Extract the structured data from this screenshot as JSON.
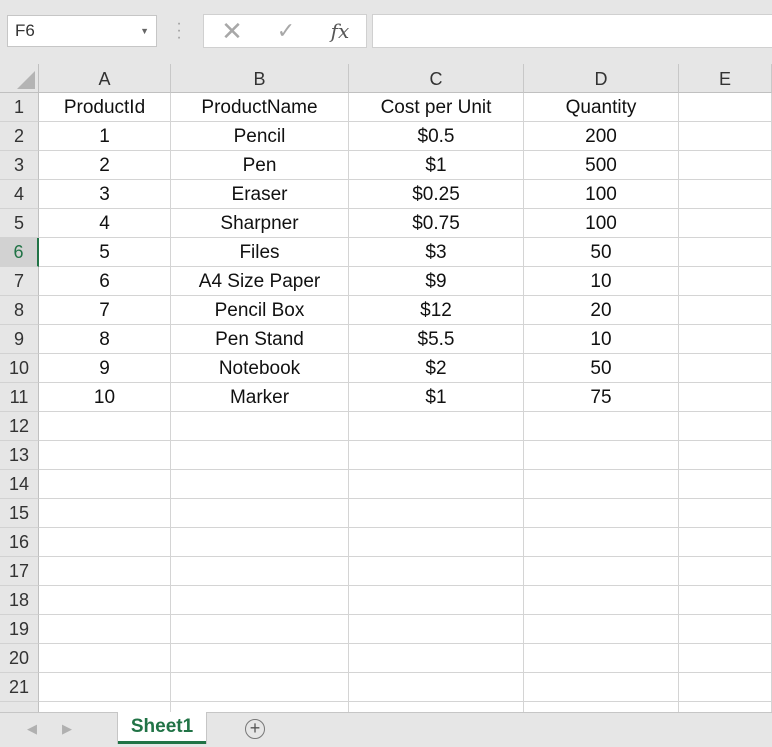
{
  "formula_bar": {
    "name_box": "F6",
    "fx_label": "fx",
    "formula": ""
  },
  "columns": [
    "A",
    "B",
    "C",
    "D",
    "E"
  ],
  "row_numbers": [
    "1",
    "2",
    "3",
    "4",
    "5",
    "6",
    "7",
    "8",
    "9",
    "10",
    "11",
    "12",
    "13",
    "14",
    "15",
    "16",
    "17",
    "18",
    "19",
    "20",
    "21"
  ],
  "active_row": "6",
  "cells": [
    [
      "ProductId",
      "ProductName",
      "Cost per Unit",
      "Quantity",
      ""
    ],
    [
      "1",
      "Pencil",
      "$0.5",
      "200",
      ""
    ],
    [
      "2",
      "Pen",
      "$1",
      "500",
      ""
    ],
    [
      "3",
      "Eraser",
      "$0.25",
      "100",
      ""
    ],
    [
      "4",
      "Sharpner",
      "$0.75",
      "100",
      ""
    ],
    [
      "5",
      "Files",
      "$3",
      "50",
      ""
    ],
    [
      "6",
      "A4 Size Paper",
      "$9",
      "10",
      ""
    ],
    [
      "7",
      "Pencil Box",
      "$12",
      "20",
      ""
    ],
    [
      "8",
      "Pen Stand",
      "$5.5",
      "10",
      ""
    ],
    [
      "9",
      "Notebook",
      "$2",
      "50",
      ""
    ],
    [
      "10",
      "Marker",
      "$1",
      "75",
      ""
    ]
  ],
  "sheets": [
    "Sheet1"
  ],
  "colors": {
    "accent": "#217346",
    "header_bg": "#e6e6e6",
    "gridline": "#d4d4d4"
  },
  "icons": {
    "name_box_dropdown": "chevron-down-icon",
    "cancel": "close-icon",
    "enter": "check-icon",
    "function": "fx-icon",
    "prev_sheet": "chevron-left-icon",
    "next_sheet": "chevron-right-icon",
    "add_sheet": "plus-circle-icon"
  }
}
